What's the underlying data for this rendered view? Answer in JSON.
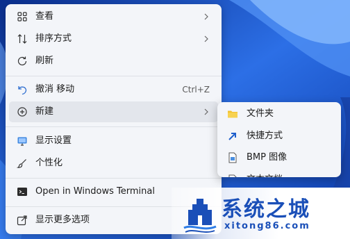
{
  "context_menu": {
    "items": [
      {
        "label": "查看",
        "icon": "grid-icon"
      },
      {
        "label": "排序方式",
        "icon": "sort-icon"
      },
      {
        "label": "刷新",
        "icon": "refresh-icon"
      },
      {
        "label": "撤消 移动",
        "icon": "undo-icon",
        "shortcut": "Ctrl+Z"
      },
      {
        "label": "新建",
        "icon": "plus-circle-icon"
      },
      {
        "label": "显示设置",
        "icon": "display-icon"
      },
      {
        "label": "个性化",
        "icon": "brush-icon"
      },
      {
        "label": "Open in Windows Terminal",
        "icon": "terminal-icon"
      },
      {
        "label": "显示更多选项",
        "icon": "share-icon"
      }
    ]
  },
  "submenu": {
    "items": [
      {
        "label": "文件夹",
        "icon": "folder-icon"
      },
      {
        "label": "快捷方式",
        "icon": "shortcut-icon"
      },
      {
        "label": "BMP 图像",
        "icon": "image-file-icon"
      },
      {
        "label": "文本文档",
        "icon": "text-file-icon"
      }
    ]
  },
  "watermark": {
    "name": "系统之城",
    "url": "xitong86.com"
  },
  "colors": {
    "wallpaper": "#1d5fd6",
    "menu_bg": "#f3f5f9",
    "hover_bg": "#e3e6ec",
    "folder": "#f2c230",
    "brand": "#1a4fb8"
  }
}
